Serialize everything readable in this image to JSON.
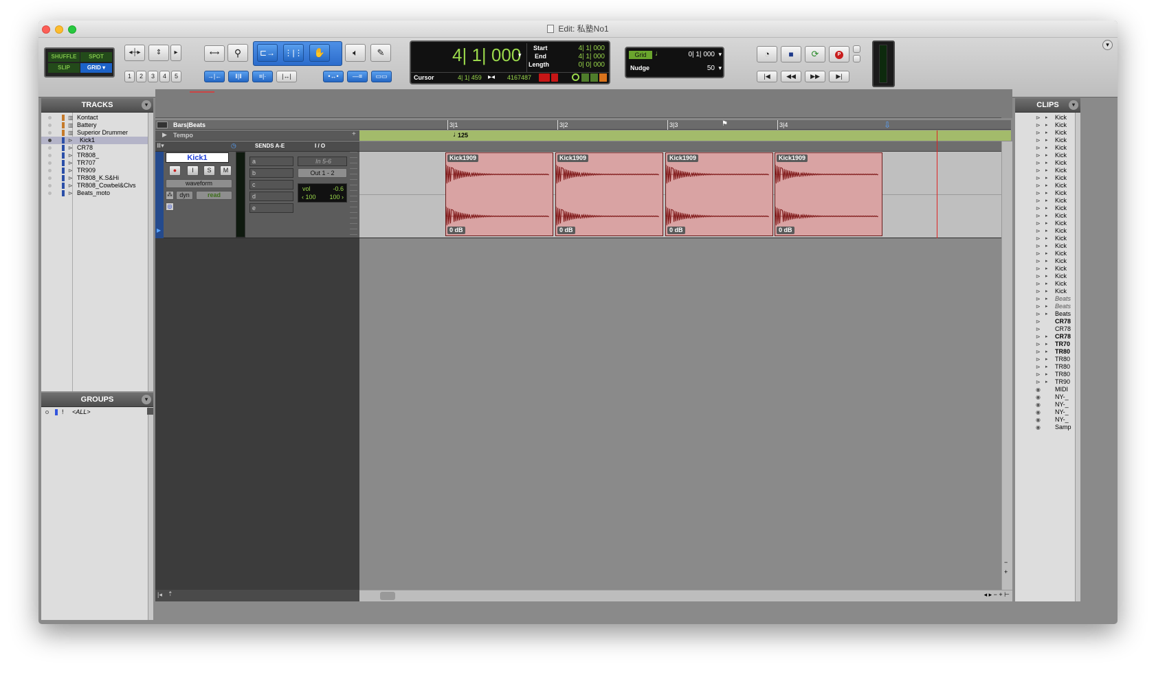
{
  "window": {
    "title": "Edit: 私塾No1"
  },
  "edit_modes": {
    "shuffle": "SHUFFLE",
    "spot": "SPOT",
    "slip": "SLIP",
    "grid": "GRID"
  },
  "zoom_presets": [
    "1",
    "2",
    "3",
    "4",
    "5"
  ],
  "counter": {
    "main": "4| 1| 000",
    "start_label": "Start",
    "start": "4| 1| 000",
    "end_label": "End",
    "end": "4| 1| 000",
    "length_label": "Length",
    "length": "0| 0| 000",
    "cursor_label": "Cursor",
    "cursor": "4| 1| 459",
    "sample": "4167487"
  },
  "grid": {
    "label": "Grid",
    "value": "0| 1| 000",
    "nudge_label": "Nudge",
    "nudge_value": "50"
  },
  "tracks_panel": {
    "title": "TRACKS",
    "items": [
      "Kontact",
      "Battery",
      "Superior Drummer",
      "Kick1",
      "CR78",
      "TR808_",
      "TR707",
      "TR909",
      "TR808_K.S&Hi",
      "TR808_Cowbel&Clvs",
      "Beats_moto"
    ]
  },
  "groups_panel": {
    "title": "GROUPS",
    "items": [
      "<ALL>"
    ]
  },
  "clips_panel": {
    "title": "CLIPS",
    "items": [
      "Kick",
      "Kick",
      "Kick",
      "Kick",
      "Kick",
      "Kick",
      "Kick",
      "Kick",
      "Kick",
      "Kick",
      "Kick",
      "Kick",
      "Kick",
      "Kick",
      "Kick",
      "Kick",
      "Kick",
      "Kick",
      "Kick",
      "Kick",
      "Kick",
      "Kick",
      "Kick",
      "Kick",
      "Beats",
      "Beats",
      "Beats",
      "CR78",
      "CR78",
      "CR78",
      "TR70",
      "TR80",
      "TR80",
      "TR80",
      "TR80",
      "TR90",
      "MIDI",
      "NY-_",
      "NY-_",
      "NY-_",
      "NY-_",
      "Samp"
    ]
  },
  "rulers": {
    "bars_beats": "Bars|Beats",
    "tempo": "Tempo",
    "tempo_value": "125",
    "markers": [
      "3|1",
      "3|2",
      "3|3",
      "3|4"
    ]
  },
  "columns": {
    "sends": "SENDS A-E",
    "io": "I / O"
  },
  "track": {
    "name": "Kick1",
    "record": "●",
    "input": "I",
    "solo": "S",
    "mute": "M",
    "view": "waveform",
    "automation": "read",
    "dyn": "dyn",
    "sends": [
      "a",
      "b",
      "c",
      "d",
      "e"
    ],
    "input_path": "In 5-6",
    "output_path": "Out 1 - 2",
    "vol_label": "vol",
    "vol_value": "-0.6",
    "pan_left": "‹ 100",
    "pan_right": "100 ›"
  },
  "clips": [
    {
      "name": "Kick1909",
      "gain": "0 dB"
    },
    {
      "name": "Kick1909",
      "gain": "0 dB"
    },
    {
      "name": "Kick1909",
      "gain": "0 dB"
    },
    {
      "name": "Kick1909",
      "gain": "0 dB"
    }
  ],
  "colors": {
    "clip_fill": "#d9a3a3",
    "waveform": "#7a1010",
    "lcd_green": "#9bd94b",
    "tempo_ruler": "#9ab55a"
  }
}
